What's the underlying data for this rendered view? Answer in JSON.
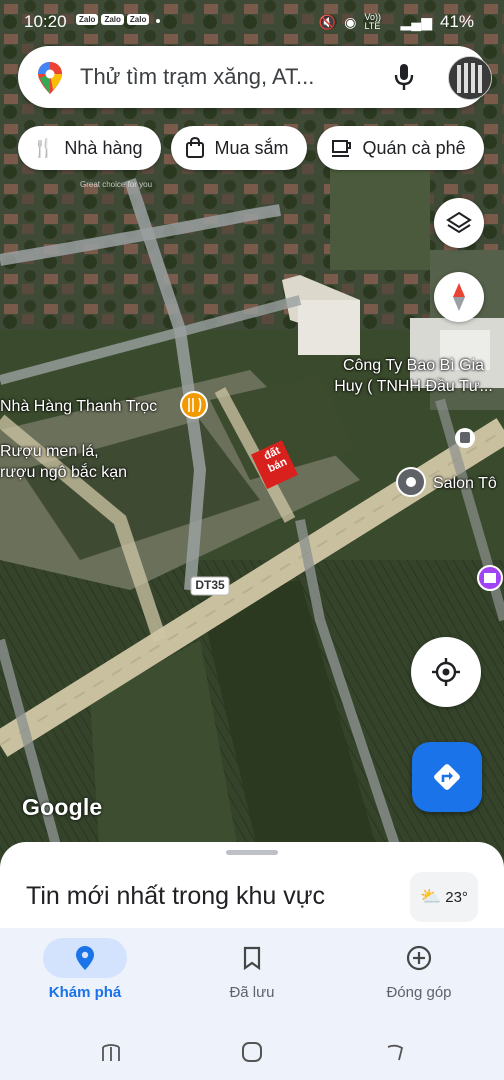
{
  "status_bar": {
    "time": "10:20",
    "badges": [
      "Zalo",
      "Zalo",
      "Zalo"
    ],
    "network": "Vo)) LTE",
    "battery": "41%"
  },
  "search": {
    "placeholder": "Thử tìm trạm xăng, AT..."
  },
  "chips": [
    {
      "label": "Nhà hàng",
      "icon": "restaurant-icon"
    },
    {
      "label": "Mua sắm",
      "icon": "shopping-bag-icon"
    },
    {
      "label": "Quán cà phê",
      "icon": "coffee-icon"
    }
  ],
  "map": {
    "labels": {
      "company": "Công Ty Bao Bì Gia\nHuy ( TNHH Đầu Tư...",
      "restaurant": "Nhà Hàng Thanh Trọc",
      "restaurant_desc": "Rượu men lá,\nrượu ngô bắc kạn",
      "salon": "Salon Tô",
      "road": "DT35",
      "sale_sign": "đất\nbán",
      "watermark_sub": "Great choice for you"
    },
    "attribution": "Google"
  },
  "sheet": {
    "title": "Tin mới nhất trong khu vực",
    "temperature": "23°"
  },
  "bottom_nav": [
    {
      "label": "Khám phá",
      "icon": "explore-pin-icon",
      "active": true
    },
    {
      "label": "Đã lưu",
      "icon": "bookmark-icon",
      "active": false
    },
    {
      "label": "Đóng góp",
      "icon": "add-circle-icon",
      "active": false
    }
  ],
  "colors": {
    "accent": "#1a73e8",
    "sheet": "#ffffff",
    "nav_bg": "#eef2fb",
    "active_pill": "#d3e3fd"
  }
}
